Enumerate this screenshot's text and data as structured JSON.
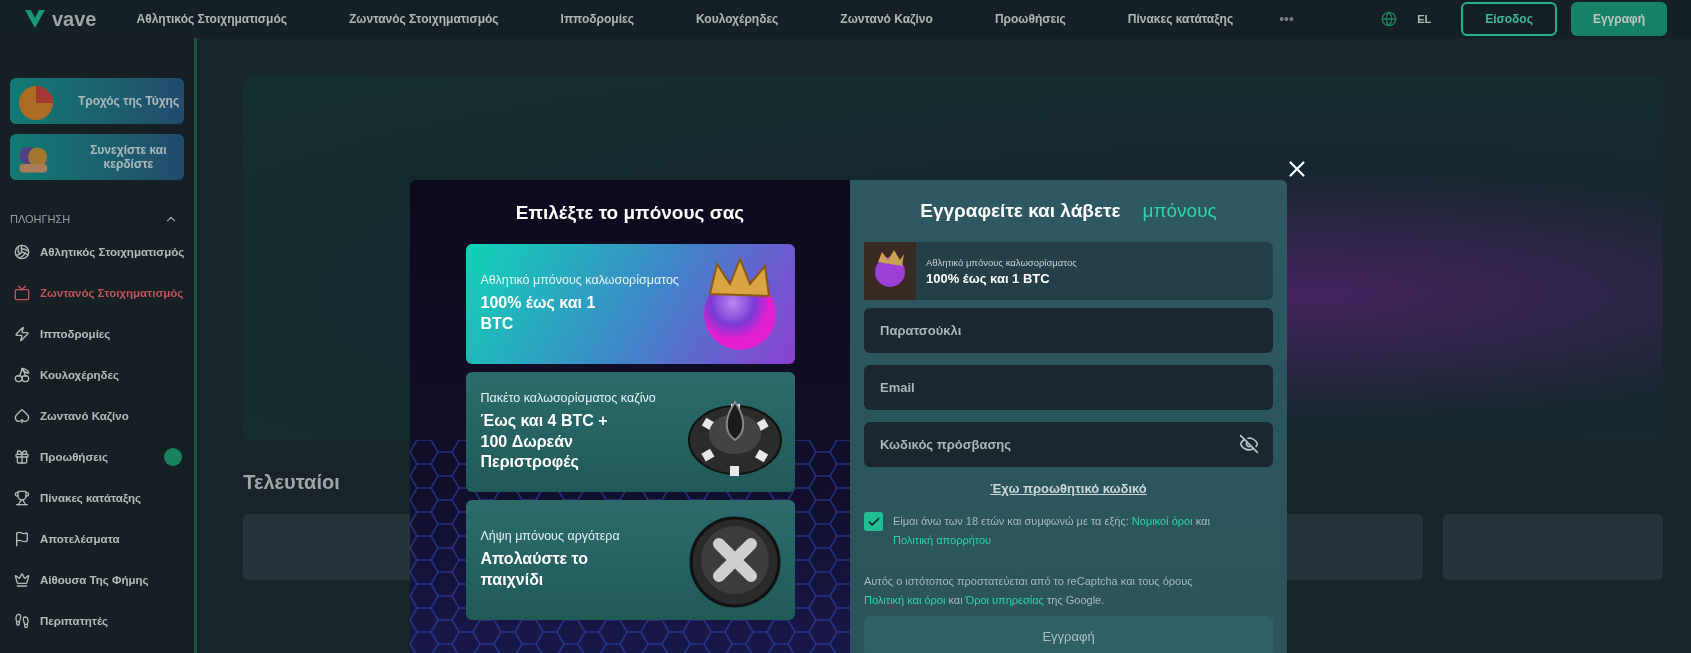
{
  "header": {
    "logo": "vave",
    "nav": [
      "Αθλητικός Στοιχηματισμός",
      "Ζωντανός Στοιχηματισμός",
      "Ιπποδρομίες",
      "Κουλοχέρηδες",
      "Ζωντανό Καζίνο",
      "Προωθήσεις",
      "Πίνακες κατάταξης"
    ],
    "more": "•••",
    "language": "EL",
    "login": "Είσοδος",
    "register": "Εγγραφή"
  },
  "sidebar": {
    "promos": [
      {
        "label": "Τροχός της Τύχης",
        "kind": "wheel"
      },
      {
        "label": "Συνεχίστε και κερδίστε",
        "kind": "coins"
      }
    ],
    "section": "ΠΛΟΗΓΗΣΗ",
    "expanded": true,
    "items": [
      {
        "label": "Αθλητικός Στοιχηματισμός",
        "selected": false,
        "badge": false
      },
      {
        "label": "Ζωντανός Στοιχηματισμός",
        "selected": true,
        "badge": false
      },
      {
        "label": "Ιπποδρομίες",
        "selected": false,
        "badge": false
      },
      {
        "label": "Κουλοχέρηδες",
        "selected": false,
        "badge": false
      },
      {
        "label": "Ζωντανό Καζίνο",
        "selected": false,
        "badge": false
      },
      {
        "label": "Προωθήσεις",
        "selected": false,
        "badge": true
      },
      {
        "label": "Πίνακες κατάταξης",
        "selected": false,
        "badge": false
      },
      {
        "label": "Αποτελέσματα",
        "selected": false,
        "badge": false
      },
      {
        "label": "Αίθουσα Της Φήμης",
        "selected": false,
        "badge": false
      },
      {
        "label": "Περιπατητές",
        "selected": false,
        "badge": false
      }
    ]
  },
  "main": {
    "section_title": "Τελευταίοι"
  },
  "modal": {
    "left": {
      "title": "Επιλέξτε το μπόνους σας",
      "bonuses": [
        {
          "kind": "sport",
          "subtitle": "Αθλητικό μπόνους καλωσορίσματος",
          "title": "100% έως και 1 BTC"
        },
        {
          "kind": "casino",
          "subtitle": "Πακέτο καλωσορίσματος καζίνο",
          "title": "Έως και 4 BTC + 100 Δωρεάν Περιστροφές"
        },
        {
          "kind": "none",
          "subtitle": "Λήψη μπόνους αργότερα",
          "title": "Απολαύστε το παιχνίδι"
        }
      ]
    },
    "right": {
      "title": "Εγγραφείτε και λάβετε",
      "title_accent": "μπόνους",
      "selected_bonus": {
        "subtitle": "Αθλητικό μπόνους καλωσορίσματος",
        "title": "100% έως και 1 BTC"
      },
      "fields": [
        {
          "kind": "text",
          "placeholder": "Παρατσούκλι"
        },
        {
          "kind": "email",
          "placeholder": "Email"
        },
        {
          "kind": "password",
          "placeholder": "Κωδικός πρόσβασης"
        }
      ],
      "promo_link": "Έχω προωθητικό κωδικό",
      "consent": {
        "checked": true,
        "parts": [
          {
            "text": "Είμαι άνω των 18 ετών και συμφωνώ με τα εξής: ",
            "kind": "plain"
          },
          {
            "text": "Νομικοί όροι",
            "kind": "link"
          },
          {
            "text": " και ",
            "kind": "plain"
          },
          {
            "text": "Πολιτική απορρήτου",
            "kind": "link"
          }
        ]
      },
      "recaptcha": {
        "parts": [
          {
            "text": "Αυτός ο ιστότοπος προστατεύεται από το reCaptcha και τους όρους ",
            "kind": "plain"
          },
          {
            "text": "Πολιτική και όροι",
            "kind": "link"
          },
          {
            "text": " και ",
            "kind": "plain"
          },
          {
            "text": "Όροι υπηρεσίας",
            "kind": "link"
          },
          {
            "text": " της Google.",
            "kind": "plain"
          }
        ]
      },
      "submit": "Εγγραφή"
    }
  }
}
